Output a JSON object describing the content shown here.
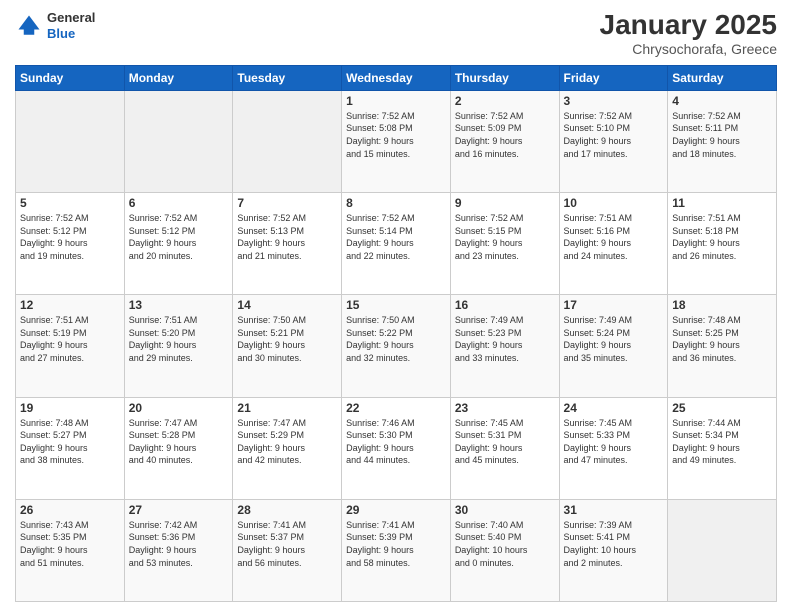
{
  "header": {
    "logo_line1": "General",
    "logo_line2": "Blue",
    "title": "January 2025",
    "subtitle": "Chrysochorafa, Greece"
  },
  "weekdays": [
    "Sunday",
    "Monday",
    "Tuesday",
    "Wednesday",
    "Thursday",
    "Friday",
    "Saturday"
  ],
  "weeks": [
    [
      {
        "day": "",
        "info": ""
      },
      {
        "day": "",
        "info": ""
      },
      {
        "day": "",
        "info": ""
      },
      {
        "day": "1",
        "info": "Sunrise: 7:52 AM\nSunset: 5:08 PM\nDaylight: 9 hours\nand 15 minutes."
      },
      {
        "day": "2",
        "info": "Sunrise: 7:52 AM\nSunset: 5:09 PM\nDaylight: 9 hours\nand 16 minutes."
      },
      {
        "day": "3",
        "info": "Sunrise: 7:52 AM\nSunset: 5:10 PM\nDaylight: 9 hours\nand 17 minutes."
      },
      {
        "day": "4",
        "info": "Sunrise: 7:52 AM\nSunset: 5:11 PM\nDaylight: 9 hours\nand 18 minutes."
      }
    ],
    [
      {
        "day": "5",
        "info": "Sunrise: 7:52 AM\nSunset: 5:12 PM\nDaylight: 9 hours\nand 19 minutes."
      },
      {
        "day": "6",
        "info": "Sunrise: 7:52 AM\nSunset: 5:12 PM\nDaylight: 9 hours\nand 20 minutes."
      },
      {
        "day": "7",
        "info": "Sunrise: 7:52 AM\nSunset: 5:13 PM\nDaylight: 9 hours\nand 21 minutes."
      },
      {
        "day": "8",
        "info": "Sunrise: 7:52 AM\nSunset: 5:14 PM\nDaylight: 9 hours\nand 22 minutes."
      },
      {
        "day": "9",
        "info": "Sunrise: 7:52 AM\nSunset: 5:15 PM\nDaylight: 9 hours\nand 23 minutes."
      },
      {
        "day": "10",
        "info": "Sunrise: 7:51 AM\nSunset: 5:16 PM\nDaylight: 9 hours\nand 24 minutes."
      },
      {
        "day": "11",
        "info": "Sunrise: 7:51 AM\nSunset: 5:18 PM\nDaylight: 9 hours\nand 26 minutes."
      }
    ],
    [
      {
        "day": "12",
        "info": "Sunrise: 7:51 AM\nSunset: 5:19 PM\nDaylight: 9 hours\nand 27 minutes."
      },
      {
        "day": "13",
        "info": "Sunrise: 7:51 AM\nSunset: 5:20 PM\nDaylight: 9 hours\nand 29 minutes."
      },
      {
        "day": "14",
        "info": "Sunrise: 7:50 AM\nSunset: 5:21 PM\nDaylight: 9 hours\nand 30 minutes."
      },
      {
        "day": "15",
        "info": "Sunrise: 7:50 AM\nSunset: 5:22 PM\nDaylight: 9 hours\nand 32 minutes."
      },
      {
        "day": "16",
        "info": "Sunrise: 7:49 AM\nSunset: 5:23 PM\nDaylight: 9 hours\nand 33 minutes."
      },
      {
        "day": "17",
        "info": "Sunrise: 7:49 AM\nSunset: 5:24 PM\nDaylight: 9 hours\nand 35 minutes."
      },
      {
        "day": "18",
        "info": "Sunrise: 7:48 AM\nSunset: 5:25 PM\nDaylight: 9 hours\nand 36 minutes."
      }
    ],
    [
      {
        "day": "19",
        "info": "Sunrise: 7:48 AM\nSunset: 5:27 PM\nDaylight: 9 hours\nand 38 minutes."
      },
      {
        "day": "20",
        "info": "Sunrise: 7:47 AM\nSunset: 5:28 PM\nDaylight: 9 hours\nand 40 minutes."
      },
      {
        "day": "21",
        "info": "Sunrise: 7:47 AM\nSunset: 5:29 PM\nDaylight: 9 hours\nand 42 minutes."
      },
      {
        "day": "22",
        "info": "Sunrise: 7:46 AM\nSunset: 5:30 PM\nDaylight: 9 hours\nand 44 minutes."
      },
      {
        "day": "23",
        "info": "Sunrise: 7:45 AM\nSunset: 5:31 PM\nDaylight: 9 hours\nand 45 minutes."
      },
      {
        "day": "24",
        "info": "Sunrise: 7:45 AM\nSunset: 5:33 PM\nDaylight: 9 hours\nand 47 minutes."
      },
      {
        "day": "25",
        "info": "Sunrise: 7:44 AM\nSunset: 5:34 PM\nDaylight: 9 hours\nand 49 minutes."
      }
    ],
    [
      {
        "day": "26",
        "info": "Sunrise: 7:43 AM\nSunset: 5:35 PM\nDaylight: 9 hours\nand 51 minutes."
      },
      {
        "day": "27",
        "info": "Sunrise: 7:42 AM\nSunset: 5:36 PM\nDaylight: 9 hours\nand 53 minutes."
      },
      {
        "day": "28",
        "info": "Sunrise: 7:41 AM\nSunset: 5:37 PM\nDaylight: 9 hours\nand 56 minutes."
      },
      {
        "day": "29",
        "info": "Sunrise: 7:41 AM\nSunset: 5:39 PM\nDaylight: 9 hours\nand 58 minutes."
      },
      {
        "day": "30",
        "info": "Sunrise: 7:40 AM\nSunset: 5:40 PM\nDaylight: 10 hours\nand 0 minutes."
      },
      {
        "day": "31",
        "info": "Sunrise: 7:39 AM\nSunset: 5:41 PM\nDaylight: 10 hours\nand 2 minutes."
      },
      {
        "day": "",
        "info": ""
      }
    ]
  ]
}
